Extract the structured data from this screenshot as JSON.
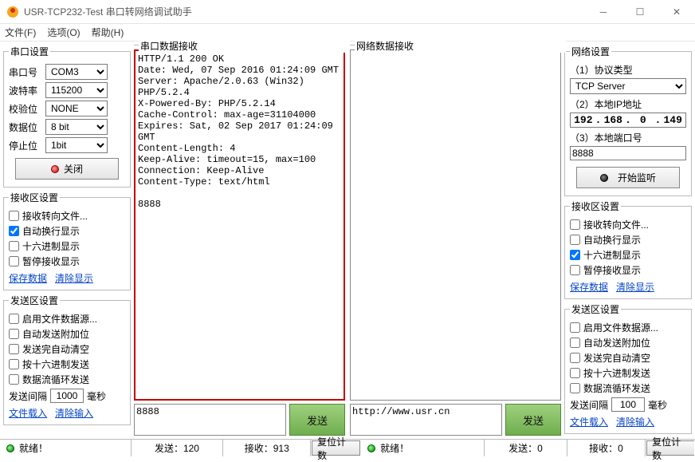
{
  "window": {
    "title": "USR-TCP232-Test 串口转网络调试助手"
  },
  "menu": {
    "file": "文件(F)",
    "options": "选项(O)",
    "help": "帮助(H)"
  },
  "serial": {
    "legend": "串口设置",
    "port_label": "串口号",
    "port": "COM3",
    "baud_label": "波特率",
    "baud": "115200",
    "parity_label": "校验位",
    "parity": "NONE",
    "databits_label": "数据位",
    "databits": "8 bit",
    "stopbits_label": "停止位",
    "stopbits": "1bit",
    "close_btn": "关闭"
  },
  "recv_left": {
    "legend": "接收区设置",
    "to_file": "接收转向文件...",
    "auto_wrap": "自动换行显示",
    "hex": "十六进制显示",
    "pause": "暂停接收显示",
    "save": "保存数据",
    "clear": "清除显示"
  },
  "send_left": {
    "legend": "发送区设置",
    "file_src": "启用文件数据源...",
    "auto_extra": "自动发送附加位",
    "clear_after": "发送完自动清空",
    "hex_send": "按十六进制发送",
    "loop": "数据流循环发送",
    "interval_label": "发送间隔",
    "interval": "1000",
    "ms": "毫秒",
    "load": "文件载入",
    "clear": "清除输入"
  },
  "mid": {
    "serial_recv_label": "串口数据接收",
    "net_recv_label": "网络数据接收",
    "serial_recv_text": "HTTP/1.1 200 OK\nDate: Wed, 07 Sep 2016 01:24:09 GMT\nServer: Apache/2.0.63 (Win32) PHP/5.2.4\nX-Powered-By: PHP/5.2.14\nCache-Control: max-age=31104000\nExpires: Sat, 02 Sep 2017 01:24:09 GMT\nContent-Length: 4\nKeep-Alive: timeout=15, max=100\nConnection: Keep-Alive\nContent-Type: text/html\n\n8888",
    "net_recv_text": "",
    "serial_send_text": "8888",
    "net_send_text": "http://www.usr.cn",
    "send_btn": "发送"
  },
  "net": {
    "legend": "网络设置",
    "proto_label": "（1）协议类型",
    "proto": "TCP Server",
    "ip_label": "（2）本地IP地址",
    "ip": {
      "a": "192",
      "b": "168",
      "c": "0",
      "d": "149"
    },
    "port_label": "（3）本地端口号",
    "port": "8888",
    "listen_btn": "开始监听"
  },
  "recv_right": {
    "legend": "接收区设置",
    "to_file": "接收转向文件...",
    "auto_wrap": "自动换行显示",
    "hex": "十六进制显示",
    "pause": "暂停接收显示",
    "save": "保存数据",
    "clear": "清除显示"
  },
  "send_right": {
    "legend": "发送区设置",
    "file_src": "启用文件数据源...",
    "auto_extra": "自动发送附加位",
    "clear_after": "发送完自动清空",
    "hex_send": "按十六进制发送",
    "loop": "数据流循环发送",
    "interval_label": "发送间隔",
    "interval": "100",
    "ms": "毫秒",
    "load": "文件载入",
    "clear": "清除输入"
  },
  "status": {
    "ready": "就绪！",
    "s_send": "发送：120",
    "s_recv": "接收：913",
    "n_send": "发送：0",
    "n_recv": "接收：0",
    "reset": "复位计数"
  }
}
